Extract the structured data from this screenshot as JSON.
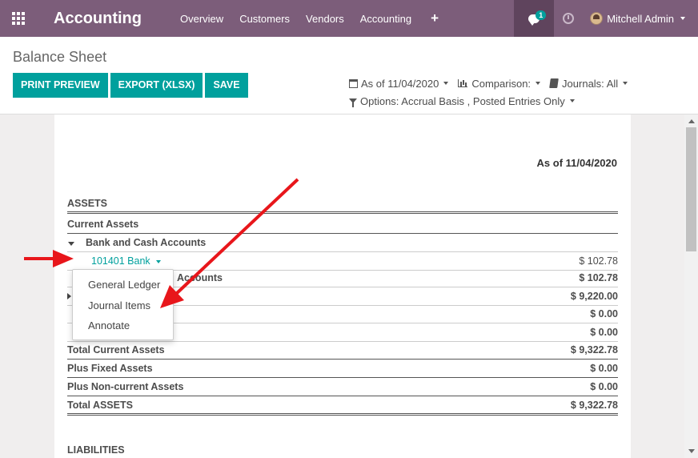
{
  "navbar": {
    "brand": "Accounting",
    "menu": [
      "Overview",
      "Customers",
      "Vendors",
      "Accounting"
    ],
    "plus": "+",
    "chat_badge": "1",
    "user_name": "Mitchell Admin",
    "bg_color": "#7c5d7a"
  },
  "control": {
    "title": "Balance Sheet",
    "buttons": [
      "PRINT PREVIEW",
      "EXPORT (XLSX)",
      "SAVE"
    ],
    "date_filter": "As of 11/04/2020",
    "comparison": "Comparison:",
    "journals": "Journals: All",
    "options": "Options: Accrual Basis , Posted Entries Only",
    "accent_color": "#00a09d"
  },
  "report": {
    "as_of": "As of 11/04/2020",
    "assets": "ASSETS",
    "current_assets": "Current Assets",
    "bank_cash": "Bank and Cash Accounts",
    "bank_account": "101401 Bank",
    "bank_account_amount": "$ 102.78",
    "total_bank_cash_partial": "Accounts",
    "total_bank_cash_amount": "$ 102.78",
    "receivables_amount": "$ 9,220.00",
    "current_assets_amount": "$ 0.00",
    "prepayments_amount": "$ 0.00",
    "total_current_assets": "Total Current Assets",
    "total_current_assets_amount": "$ 9,322.78",
    "plus_fixed_assets": "Plus Fixed Assets",
    "plus_fixed_assets_amount": "$ 0.00",
    "plus_non_current_assets": "Plus Non-current Assets",
    "plus_non_current_assets_amount": "$ 0.00",
    "total_assets": "Total ASSETS",
    "total_assets_amount": "$ 9,322.78",
    "liabilities": "LIABILITIES"
  },
  "dropdown": {
    "items": [
      "General Ledger",
      "Journal Items",
      "Annotate"
    ]
  },
  "annotations": {
    "arrow_color": "#e8161b"
  }
}
